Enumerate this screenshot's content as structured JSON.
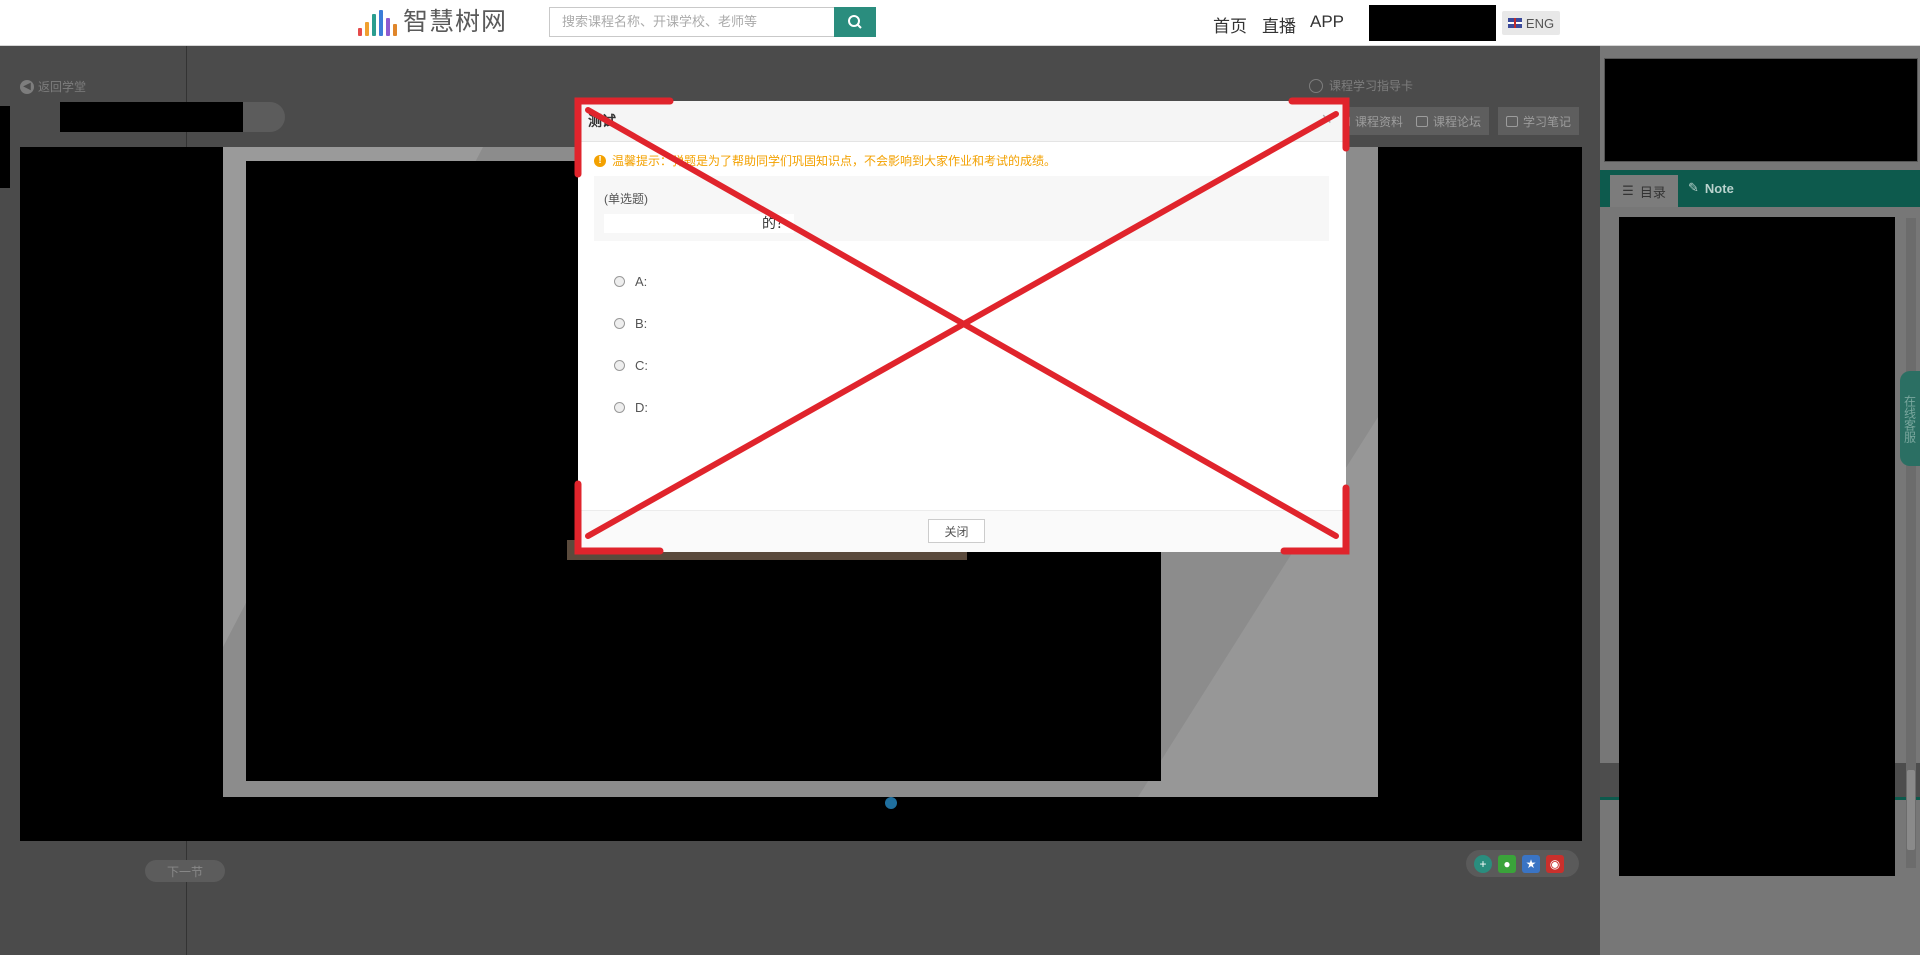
{
  "header": {
    "logo_text": "智慧树网",
    "search_placeholder": "搜索课程名称、开课学校、老师等",
    "nav": [
      "首页",
      "直播",
      "APP"
    ],
    "lang_label": "ENG"
  },
  "course": {
    "back_label": "返回学堂",
    "guide_label": "课程学习指导卡",
    "tools": [
      "课程资料",
      "课程论坛",
      "学习笔记"
    ],
    "next_label": "下一节"
  },
  "sidebar": {
    "tabs": [
      "目录",
      "Note"
    ],
    "service_label": "在线客服"
  },
  "modal": {
    "title": "测试",
    "close_x": "×",
    "tip": "温馨提示：弹题是为了帮助同学们巩固知识点，不会影响到大家作业和考试的成绩。",
    "question_type": "(单选题)",
    "question_text": "的？",
    "options": [
      "A:",
      "B:",
      "C:",
      "D:"
    ],
    "close_button": "关闭"
  },
  "colors": {
    "accent": "#2a8d7e",
    "tip_orange": "#f3a100",
    "annotation_red": "#e0242c",
    "sidebar_green": "#0d5a4d"
  }
}
